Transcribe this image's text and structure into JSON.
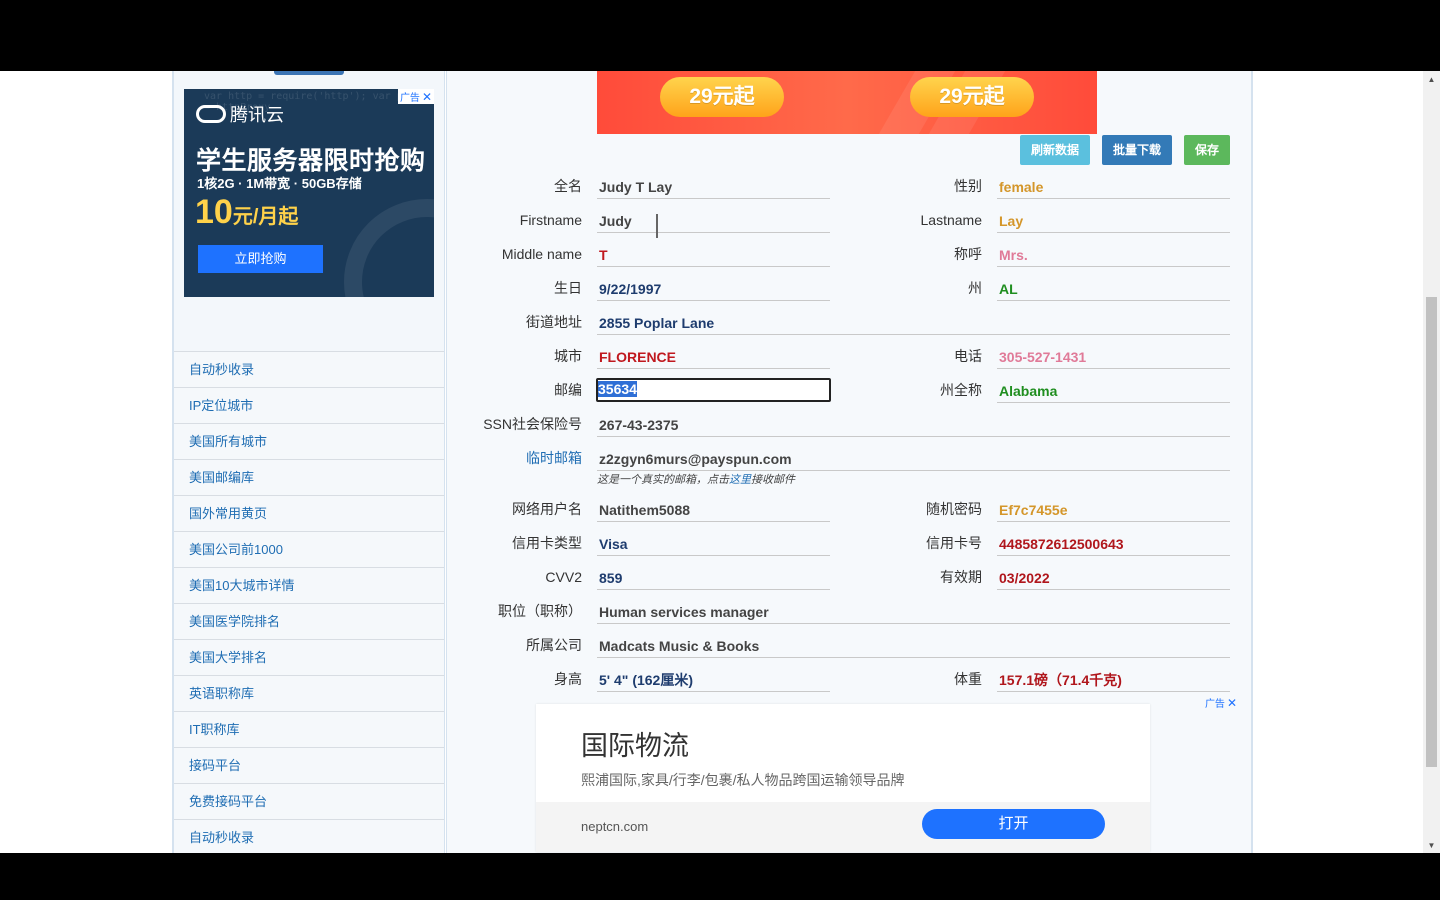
{
  "sidebar": {
    "ad": {
      "brand": "腾讯云",
      "code_bg": "var http = require('http'); var proxy = httpProxy",
      "headline": "学生服务器限时抢购",
      "specs": "1核2G · 1M带宽 · 50GB存储",
      "price": "10",
      "price_unit": "元/月起",
      "button": "立即抢购",
      "badge": "广告"
    },
    "nav_items": [
      "自动秒收录",
      "IP定位城市",
      "美国所有城市",
      "美国邮编库",
      "国外常用黄页",
      "美国公司前1000",
      "美国10大城市详情",
      "美国医学院排名",
      "美国大学排名",
      "英语职称库",
      "IT职称库",
      "接码平台",
      "免费接码平台",
      "自动秒收录"
    ]
  },
  "banner": {
    "promo_left": "29元起",
    "promo_right": "29元起"
  },
  "toolbar": {
    "refresh": "刷新数据",
    "download": "批量下载",
    "save": "保存"
  },
  "fields": {
    "fullname": {
      "label": "全名",
      "value": "Judy T Lay"
    },
    "gender": {
      "label": "性别",
      "value": "female"
    },
    "firstname": {
      "label": "Firstname",
      "value": "Judy"
    },
    "lastname": {
      "label": "Lastname",
      "value": "Lay"
    },
    "middlename": {
      "label": "Middle name",
      "value": "T"
    },
    "title": {
      "label": "称呼",
      "value": "Mrs."
    },
    "birthday": {
      "label": "生日",
      "value": "9/22/1997"
    },
    "state": {
      "label": "州",
      "value": "AL"
    },
    "street": {
      "label": "街道地址",
      "value": "2855 Poplar Lane"
    },
    "city": {
      "label": "城市",
      "value": "FLORENCE"
    },
    "phone": {
      "label": "电话",
      "value": "305-527-1431"
    },
    "zip": {
      "label": "邮编",
      "value": "35634"
    },
    "state_full": {
      "label": "州全称",
      "value": "Alabama"
    },
    "ssn": {
      "label": "SSN社会保险号",
      "value": "267-43-2375"
    },
    "email": {
      "label": "临时邮箱",
      "value": "z2zgyn6murs@payspun.com"
    },
    "username": {
      "label": "网络用户名",
      "value": "Natithem5088"
    },
    "password": {
      "label": "随机密码",
      "value": "Ef7c7455e"
    },
    "card_type": {
      "label": "信用卡类型",
      "value": "Visa"
    },
    "card_number": {
      "label": "信用卡号",
      "value": "4485872612500643"
    },
    "cvv": {
      "label": "CVV2",
      "value": "859"
    },
    "expiry": {
      "label": "有效期",
      "value": "03/2022"
    },
    "job": {
      "label": "职位（职称）",
      "value": "Human services manager"
    },
    "company": {
      "label": "所属公司",
      "value": "Madcats Music & Books"
    },
    "height": {
      "label": "身高",
      "value": "5' 4\"  (162厘米)"
    },
    "weight": {
      "label": "体重",
      "value": "157.1磅（71.4千克)"
    }
  },
  "email_hint": {
    "before": "这是一个真实的邮箱，点击",
    "link": "这里",
    "after": "接收邮件"
  },
  "bottom_ad": {
    "badge": "广告",
    "title": "国际物流",
    "desc": "熙浦国际,家具/行李/包裹/私人物品跨国运输领导品牌",
    "domain": "neptcn.com",
    "button": "打开"
  }
}
